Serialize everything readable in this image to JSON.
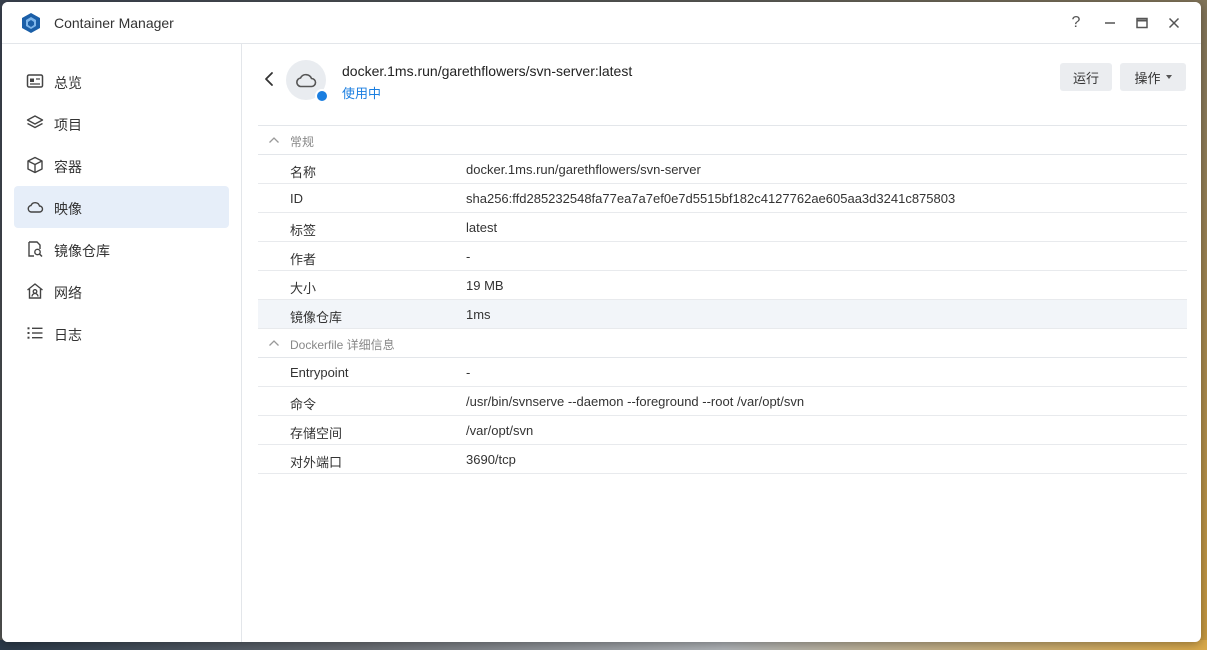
{
  "app": {
    "title": "Container Manager",
    "window_controls": {
      "help": "?",
      "minimize": "—",
      "maximize": "▭",
      "close": "✕"
    }
  },
  "sidebar": {
    "items": [
      {
        "label": "总览",
        "icon": "dashboard-icon",
        "active": false
      },
      {
        "label": "项目",
        "icon": "layers-icon",
        "active": false
      },
      {
        "label": "容器",
        "icon": "cube-icon",
        "active": false
      },
      {
        "label": "映像",
        "icon": "cloud-icon",
        "active": true
      },
      {
        "label": "镜像仓库",
        "icon": "registry-search-icon",
        "active": false
      },
      {
        "label": "网络",
        "icon": "network-home-icon",
        "active": false
      },
      {
        "label": "日志",
        "icon": "list-icon",
        "active": false
      }
    ]
  },
  "header": {
    "image_name": "docker.1ms.run/garethflowers/svn-server:latest",
    "status": "使用中",
    "run_label": "运行",
    "actions_label": "操作"
  },
  "sections": {
    "general": {
      "title": "常规",
      "rows": [
        {
          "key": "名称",
          "value": "docker.1ms.run/garethflowers/svn-server"
        },
        {
          "key": "ID",
          "value": "sha256:ffd285232548fa77ea7a7ef0e7d5515bf182c4127762ae605aa3d3241c875803"
        },
        {
          "key": "标签",
          "value": "latest"
        },
        {
          "key": "作者",
          "value": "-"
        },
        {
          "key": "大小",
          "value": "19 MB"
        },
        {
          "key": "镜像仓库",
          "value": "1ms"
        }
      ]
    },
    "dockerfile": {
      "title": "Dockerfile 详细信息",
      "rows": [
        {
          "key": "Entrypoint",
          "value": "-"
        },
        {
          "key": "命令",
          "value": "/usr/bin/svnserve --daemon --foreground --root /var/opt/svn"
        },
        {
          "key": "存储空间",
          "value": "/var/opt/svn"
        },
        {
          "key": "对外端口",
          "value": "3690/tcp"
        }
      ]
    }
  },
  "colors": {
    "accent": "#1a7ee0",
    "active_nav_bg": "#e6eef9"
  }
}
